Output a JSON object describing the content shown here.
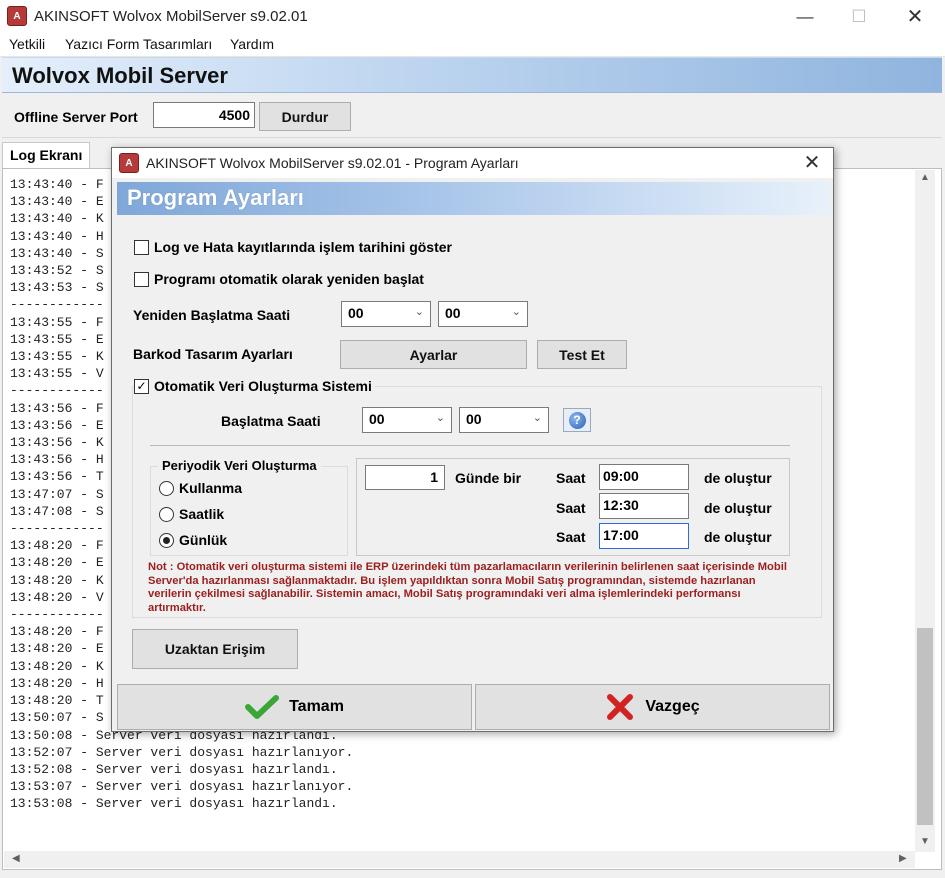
{
  "window": {
    "title": "AKINSOFT Wolvox MobilServer s9.02.01",
    "icon_text": "A"
  },
  "menu": [
    "Yetkili",
    "Yazıcı Form Tasarımları",
    "Yardım"
  ],
  "header": {
    "title": "Wolvox Mobil Server"
  },
  "toolbar": {
    "port_label": "Offline Server Port",
    "port_value": "4500",
    "stop_label": "Durdur"
  },
  "log_tab": "Log Ekranı",
  "log_lines": [
    "13:43:40 - F",
    "13:43:40 - E",
    "13:43:40 - K",
    "13:43:40 - H",
    "13:43:40 - S",
    "13:43:52 - S",
    "13:43:53 - S",
    "------------",
    "13:43:55 - F",
    "13:43:55 - E",
    "13:43:55 - K",
    "13:43:55 - V",
    "------------",
    "13:43:56 - F",
    "13:43:56 - E",
    "13:43:56 - K",
    "13:43:56 - H",
    "13:43:56 - T",
    "13:47:07 - S",
    "13:47:08 - S",
    "------------",
    "13:48:20 - F",
    "13:48:20 - E",
    "13:48:20 - K",
    "13:48:20 - V",
    "------------",
    "13:48:20 - F",
    "13:48:20 - E",
    "13:48:20 - K",
    "13:48:20 - H",
    "13:48:20 - T",
    "13:50:07 - S",
    "13:50:08 - Server veri dosyası hazırlandı.",
    "13:52:07 - Server veri dosyası hazırlanıyor.",
    "13:52:08 - Server veri dosyası hazırlandı.",
    "13:53:07 - Server veri dosyası hazırlanıyor.",
    "13:53:08 - Server veri dosyası hazırlandı."
  ],
  "dialog": {
    "title": "AKINSOFT Wolvox MobilServer s9.02.01 - Program Ayarları",
    "header": "Program Ayarları",
    "chk_log_date": {
      "label": "Log ve Hata kayıtlarında işlem tarihini göster",
      "checked": false
    },
    "chk_auto_restart": {
      "label": "Programı otomatik olarak yeniden başlat",
      "checked": false
    },
    "restart_time_label": "Yeniden Başlatma Saati",
    "restart_hour": "00",
    "restart_minute": "00",
    "barcode_label": "Barkod Tasarım Ayarları",
    "settings_btn": "Ayarlar",
    "test_btn": "Test Et",
    "auto_data": {
      "label": "Otomatik Veri Oluşturma Sistemi",
      "checked": true
    },
    "start_time_label": "Başlatma Saati",
    "start_hour": "00",
    "start_minute": "00",
    "periodic": {
      "title": "Periyodik Veri Oluşturma",
      "options": [
        "Kullanma",
        "Saatlik",
        "Günlük"
      ],
      "selected": "Günlük"
    },
    "days_value": "1",
    "days_label": "Günde bir",
    "saat_label": "Saat",
    "times": [
      "09:00",
      "12:30",
      "17:00"
    ],
    "create_label": "de oluştur",
    "note": "Not : Otomatik veri oluşturma sistemi ile ERP üzerindeki tüm pazarlamacıların verilerinin belirlenen saat içerisinde Mobil Server'da hazırlanması sağlanmaktadır. Bu işlem yapıldıktan sonra Mobil Satış programından, sistemde hazırlanan verilerin çekilmesi sağlanabilir. Sistemin amacı, Mobil Satış programındaki veri alma işlemlerindeki performansı artırmaktır.",
    "remote_btn": "Uzaktan Erişim",
    "ok_btn": "Tamam",
    "cancel_btn": "Vazgeç"
  },
  "colors": {
    "header_gradient_end": "#8fb4de",
    "note_text": "#9c1e1e",
    "ok_check": "#3aa635",
    "cancel_x": "#d32222"
  },
  "icons": {
    "help": "question-icon",
    "ok": "check-icon",
    "cancel": "x-icon"
  }
}
